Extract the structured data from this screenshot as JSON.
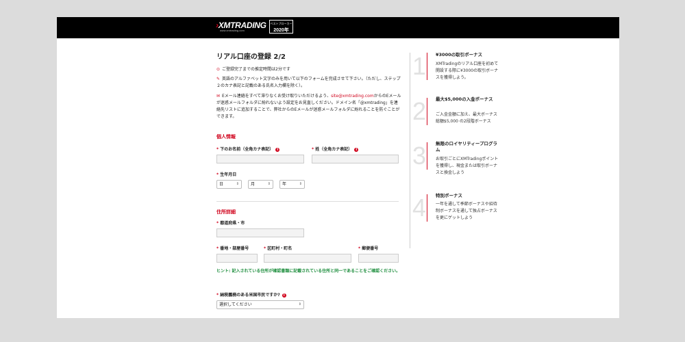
{
  "header": {
    "logo": "XMTRADING",
    "logo_sub": "www.xmtrading.com",
    "badge_line1": "ベストブローカー",
    "badge_line2": "2020年"
  },
  "form": {
    "title": "リアル口座の登録 2/2",
    "notes": [
      {
        "icon": "clock-icon",
        "text": "ご登録完了までの推定時間は2分です"
      },
      {
        "icon": "pencil-icon",
        "text": "英語のアルファベット文字のみを用いて以下のフォームを完成させて下さい。（ただし、ステップ２のカナ表記と記載のある氏名入力欄を除く）。"
      },
      {
        "icon": "mail-icon",
        "text_before": "Eメール連絡をすべて滞りなくお受け取りいただけるよう、",
        "email": "site@xmtrading.com",
        "text_after": "からのEメールが迷惑メールフォルダに紛れないよう設定をお見直しください。ドメイン名「@xmtrading」を連絡先リストに追加することで、弊社からのEメールが迷惑メールフォルダに紛れることを防ぐことができます。"
      }
    ],
    "personal_section": "個人情報",
    "first_name_label": "下のお名前（全角カナ表記）",
    "last_name_label": "姓（全角カナ表記）",
    "dob_label": "生年月日",
    "dob_day": "日",
    "dob_month": "月",
    "dob_year": "年",
    "address_section": "住所詳細",
    "prefecture_label": "都道府県・市",
    "street_label": "番地・部屋番号",
    "ward_label": "区町村・町名",
    "postal_label": "郵便番号",
    "hint": "ヒント: 記入されている住所が確認書類に記載されている住所と同一であることをご確認ください。",
    "us_citizen_label": "納税義務のある米国市民ですか?",
    "us_citizen_value": "選択してください",
    "required_mark": "*"
  },
  "sidebar": {
    "steps": [
      {
        "num": "1",
        "title": "¥3000の取引ボーナス",
        "desc": "XMTradingのリアル口座を初めて開設する際に¥3000の取引ボーナスを獲得しよう。"
      },
      {
        "num": "2",
        "title": "最大$5,000の入金ボーナス",
        "desc": "ご入金金額に加え、最大ボーナス総額$5,000 の2段階ボーナス"
      },
      {
        "num": "3",
        "title": "無限のロイヤリティープログラム",
        "desc": "お取引ごとにXMTradingポイントを獲得し、現金または取引ボーナスと換金しよう"
      },
      {
        "num": "4",
        "title": "特別ボーナス",
        "desc": "一年を通して季節ボーナスや招待制ボーナスを通して独占ボーナスを更にゲットしよう"
      }
    ]
  },
  "colors": {
    "accent": "#d0021b",
    "hint": "#1e8e3e",
    "header_bg": "#000000"
  }
}
